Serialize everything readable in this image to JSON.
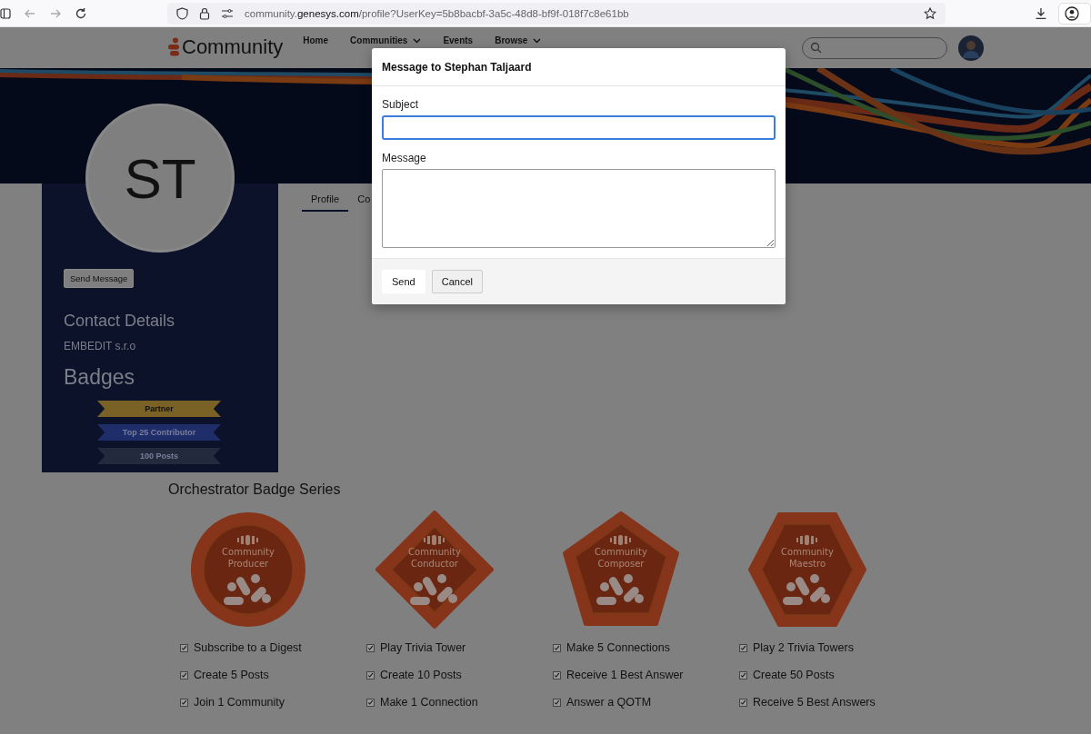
{
  "browser": {
    "url_prefix": "community.",
    "url_host": "genesys.com",
    "url_path": "/profile?UserKey=5b8bacbf-3a5c-48d8-bf9f-018f7c8e61bb"
  },
  "header": {
    "logo": "Community",
    "nav": [
      {
        "label": "Home",
        "dropdown": false
      },
      {
        "label": "Communities",
        "dropdown": true
      },
      {
        "label": "Events",
        "dropdown": false
      },
      {
        "label": "Browse",
        "dropdown": true
      }
    ]
  },
  "profile": {
    "initials": "ST",
    "send_button": "Send Message",
    "contact_heading": "Contact Details",
    "company": "EMBEDIT s.r.o",
    "badges_heading": "Badges",
    "ribbons": [
      {
        "label": "Partner",
        "color": "#7a6226"
      },
      {
        "label": "Top 25 Contributor",
        "color": "#1f2d6a"
      },
      {
        "label": "100 Posts",
        "color": "#232a3e"
      }
    ]
  },
  "tabs": [
    {
      "label": "Profile",
      "selected": true
    },
    {
      "label": "Co",
      "selected": false
    }
  ],
  "series": {
    "title": "Orchestrator Badge Series",
    "badges": [
      {
        "kind": "circle",
        "name": "Community Producer",
        "tasks": [
          {
            "label": "Subscribe to a Digest",
            "checked": true
          },
          {
            "label": "Create 5 Posts",
            "checked": true
          },
          {
            "label": "Join 1 Community",
            "checked": true
          }
        ]
      },
      {
        "kind": "diamond",
        "name": "Community Conductor",
        "tasks": [
          {
            "label": "Play Trivia Tower",
            "checked": true
          },
          {
            "label": "Create 10 Posts",
            "checked": true
          },
          {
            "label": "Make 1 Connection",
            "checked": true
          }
        ]
      },
      {
        "kind": "pentagon",
        "name": "Community Composer",
        "tasks": [
          {
            "label": "Make 5 Connections",
            "checked": true
          },
          {
            "label": "Receive 1 Best Answer",
            "checked": true
          },
          {
            "label": "Answer a QOTM",
            "checked": true
          }
        ]
      },
      {
        "kind": "hexagon",
        "name": "Community Maestro",
        "tasks": [
          {
            "label": "Play 2 Trivia Towers",
            "checked": true
          },
          {
            "label": "Create 50 Posts",
            "checked": true
          },
          {
            "label": "Receive 5 Best Answers",
            "checked": true
          }
        ]
      }
    ]
  },
  "modal": {
    "title": "Message to Stephan Taljaard",
    "fields": [
      {
        "kind": "input",
        "label": "Subject",
        "focused": true
      },
      {
        "kind": "textarea",
        "label": "Message",
        "focused": false
      }
    ],
    "buttons": [
      {
        "label": "Send",
        "kind": "primary"
      },
      {
        "label": "Cancel",
        "kind": "secondary"
      }
    ]
  }
}
